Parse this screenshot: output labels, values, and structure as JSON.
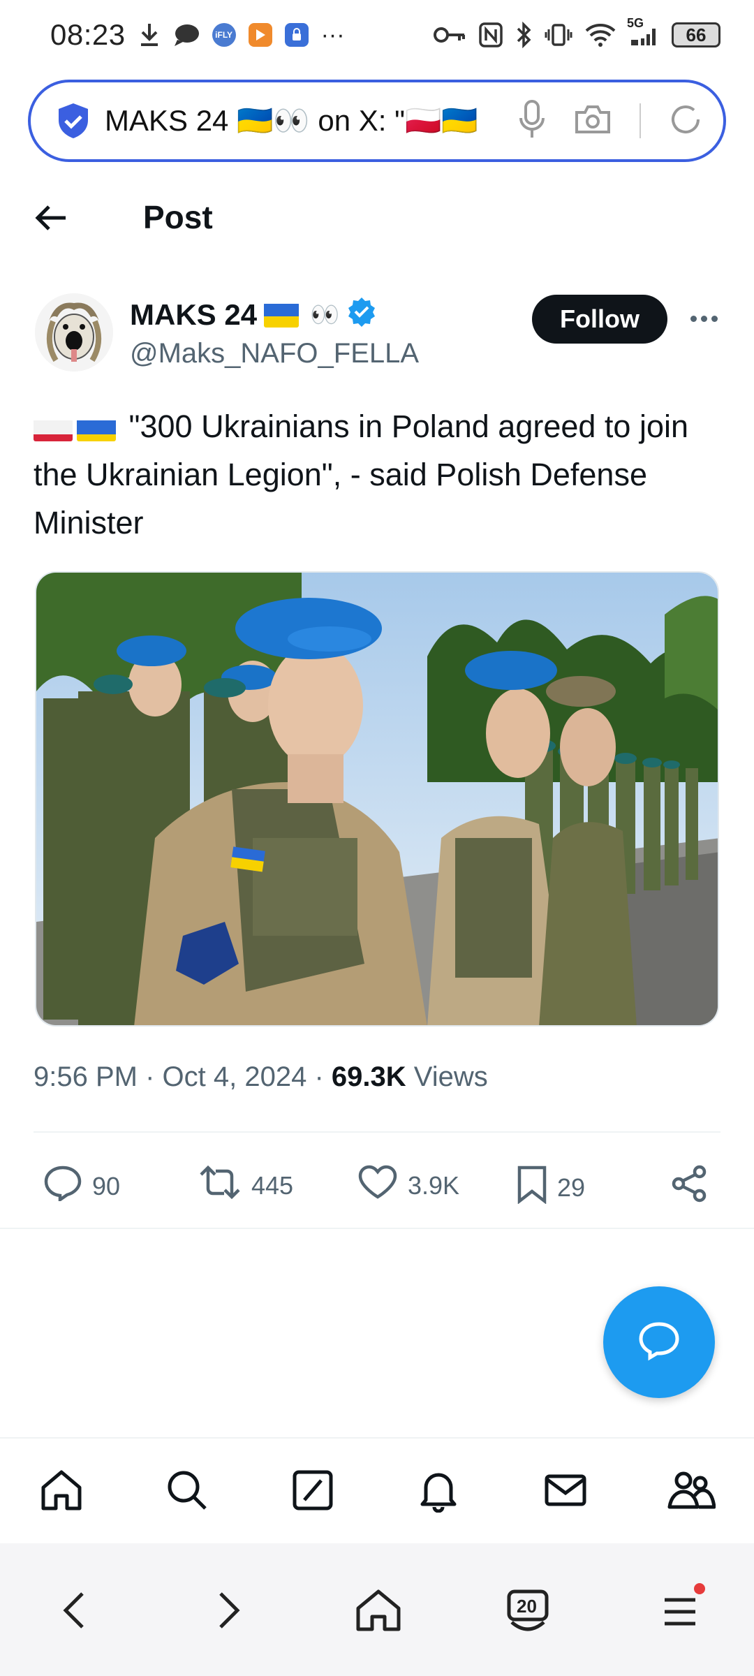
{
  "status_bar": {
    "time": "08:23",
    "network": "5G",
    "battery": "66",
    "more": "···"
  },
  "url_bar": {
    "text": "MAKS 24 🇺🇦👀 on X: \"🇵🇱🇺🇦",
    "accent": "#3b5fe0"
  },
  "header": {
    "title": "Post"
  },
  "author": {
    "name": "MAKS 24",
    "name_emoji": "👀",
    "handle": "@Maks_NAFO_FELLA",
    "verified": true
  },
  "follow_label": "Follow",
  "tweet": {
    "text": "\"300 Ukrainians in Poland agreed to join the Ukrainian Legion\", - said Polish Defense Minister",
    "photo_alt_icon": "photo"
  },
  "meta": {
    "time": "9:56 PM",
    "sep1": "·",
    "date": "Oct 4, 2024",
    "sep2": "·",
    "views_count": "69.3K",
    "views_label": "Views"
  },
  "actions": {
    "replies": "90",
    "reposts": "445",
    "likes": "3.9K",
    "bookmarks": "29"
  },
  "browser_bar": {
    "tabs_count": "20"
  },
  "colors": {
    "brand_blue": "#1d9bf0",
    "text": "#0f1419",
    "secondary": "#536471"
  }
}
